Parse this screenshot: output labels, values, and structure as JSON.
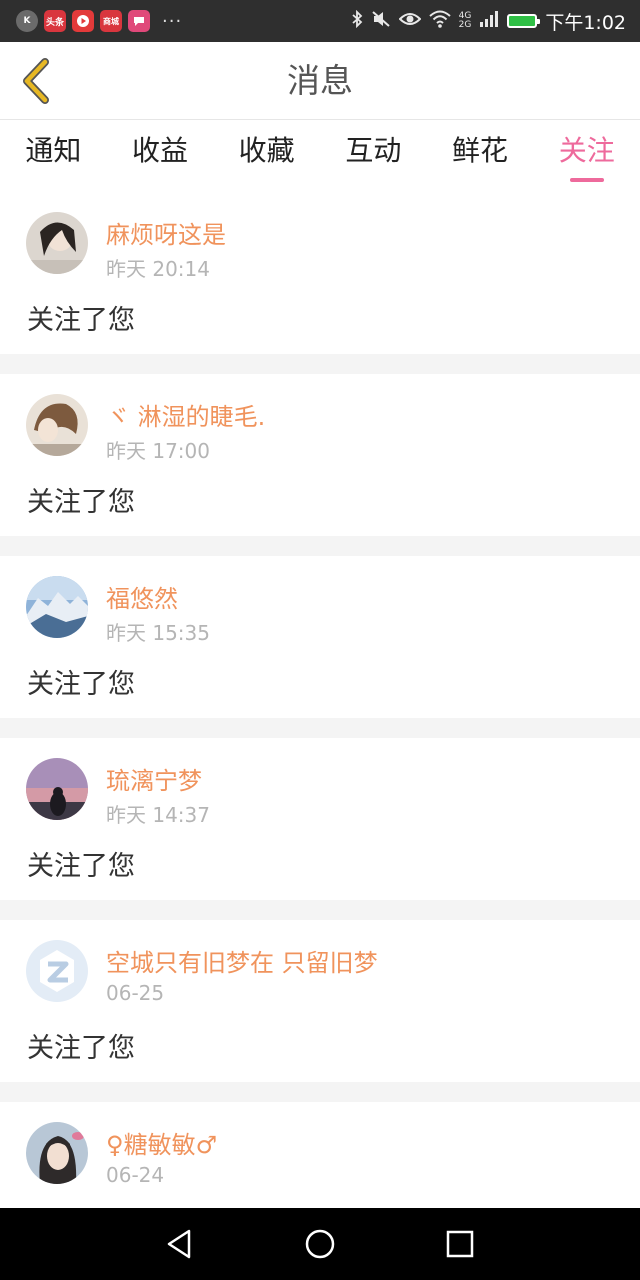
{
  "status_bar": {
    "apps": [
      {
        "icon": "k-app-icon",
        "label": "K",
        "color": "#6b6b6b"
      },
      {
        "icon": "toutiao-icon",
        "label": "头条",
        "color": "#d9363e"
      },
      {
        "icon": "video-app-icon",
        "label": "",
        "color": "#e33a3a"
      },
      {
        "icon": "shop-app-icon",
        "label": "商城",
        "color": "#d9363e"
      },
      {
        "icon": "chat-app-icon",
        "label": "",
        "color": "#e0497a"
      }
    ],
    "more": "···",
    "network": "4G\n2G",
    "time": "下午1:02"
  },
  "header": {
    "title": "消息",
    "back_icon": "chevron-left-icon",
    "back_color": "#e7b824"
  },
  "tabs": [
    {
      "label": "通知",
      "active": false
    },
    {
      "label": "收益",
      "active": false
    },
    {
      "label": "收藏",
      "active": false
    },
    {
      "label": "互动",
      "active": false
    },
    {
      "label": "鲜花",
      "active": false
    },
    {
      "label": "关注",
      "active": true
    }
  ],
  "accent_color": "#ee6a9c",
  "name_color": "#f0935c",
  "items": [
    {
      "name": "麻烦呀这是",
      "time": "昨天 20:14",
      "action": "关注了您"
    },
    {
      "name": "ヾ 淋湿的睫毛.",
      "time": "昨天 17:00",
      "action": "关注了您"
    },
    {
      "name": "福悠然",
      "time": "昨天 15:35",
      "action": "关注了您"
    },
    {
      "name": "琉漓宁梦",
      "time": "昨天 14:37",
      "action": "关注了您"
    },
    {
      "name": "空城只有旧梦在 只留旧梦",
      "time": "06-25",
      "action": "关注了您"
    },
    {
      "name": "♀糖敏敏♂",
      "time": "06-24",
      "action": ""
    }
  ],
  "nav": [
    "back-triangle-icon",
    "home-circle-icon",
    "recents-square-icon"
  ]
}
